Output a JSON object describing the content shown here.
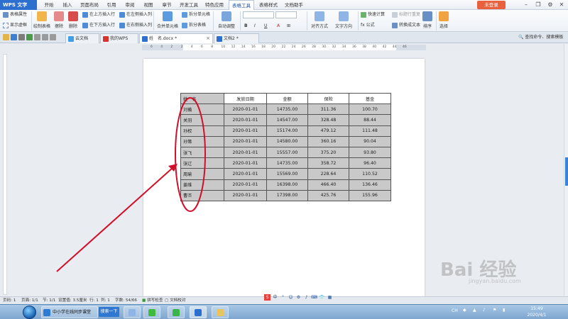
{
  "app": {
    "name": "WPS 文字",
    "login_label": "未登录"
  },
  "menu": {
    "items": [
      "开始",
      "插入",
      "页面布局",
      "引用",
      "审阅",
      "视图",
      "章节",
      "开发工具",
      "特色应用",
      "表格工具",
      "表格样式",
      "文档助手"
    ],
    "active": "表格工具"
  },
  "ribbon": {
    "table_props": "表格属性",
    "show_gridlines": "显示虚框",
    "draw_table": "绘制表格",
    "erase": "擦除",
    "delete": "删除",
    "insert_above": "在上方插入行",
    "insert_below": "在下方插入行",
    "insert_left": "在左侧插入列",
    "insert_right": "在右侧插入列",
    "merge_cells": "合并单元格",
    "split_cells": "拆分单元格",
    "split_table": "拆分表格",
    "autofit": "自动调整",
    "align": "对齐方式",
    "text_direction": "文字方向",
    "formula": "fx 公式",
    "quick_calc": "快速计算",
    "title_repeat": "标题行重复",
    "convert_text": "转换成文本",
    "sort": "排序",
    "select": "选择"
  },
  "tabs": {
    "cloud_doc": "云文档",
    "my_wps": "我的WPS",
    "doc_active": "姓　名.docx *",
    "doc2": "文档2 *",
    "find_cmd": "查找命令、搜索模板"
  },
  "ruler": {
    "ticks": [
      "6",
      "4",
      "2",
      "2",
      "4",
      "6",
      "8",
      "10",
      "12",
      "14",
      "16",
      "18",
      "20",
      "22",
      "24",
      "26",
      "28",
      "30",
      "32",
      "34",
      "36",
      "38",
      "40",
      "42",
      "44",
      "46"
    ]
  },
  "table": {
    "headers": [
      "姓　名",
      "发放日期",
      "金额",
      "保险",
      "基金"
    ],
    "rows": [
      [
        "刘備",
        "2020-01-01",
        "14735.00",
        "311.36",
        "100.70"
      ],
      [
        "关羽",
        "2020-01-01",
        "14547.00",
        "328.48",
        "88.44"
      ],
      [
        "孙权",
        "2020-01-01",
        "15174.00",
        "479.12",
        "111.48"
      ],
      [
        "孙策",
        "2020-01-01",
        "14580.00",
        "360.16",
        "90.04"
      ],
      [
        "张飞",
        "2020-01-01",
        "15557.00",
        "375.20",
        "93.80"
      ],
      [
        "张辽",
        "2020-01-01",
        "14735.00",
        "358.72",
        "96.40"
      ],
      [
        "周瑜",
        "2020-01-01",
        "15569.00",
        "228.64",
        "110.52"
      ],
      [
        "姜维",
        "2020-01-01",
        "16398.00",
        "466.40",
        "136.46"
      ],
      [
        "曹丕",
        "2020-01-01",
        "17398.00",
        "425.76",
        "155.96"
      ]
    ]
  },
  "status": {
    "page_num": "页码: 1",
    "page": "页面: 1/1",
    "section": "节: 1/1",
    "setting": "设置值: 3.5厘米",
    "row": "行: 1",
    "col": "列: 1",
    "words": "字数: 54/66",
    "spell": "拼写检查",
    "proofread": "文档校对"
  },
  "taskbar": {
    "browser_item": "中小学在线同步课堂",
    "search_btn": "搜索一下",
    "time": "15:49",
    "date": "2020/4/1",
    "ime_label": "CH"
  },
  "watermark": {
    "logo": "Bai 经验",
    "url": "jingyan.baidu.com"
  },
  "colors": {
    "accent": "#2c6fcf",
    "annotation": "#d0102a",
    "selection": "#c9c9c9"
  }
}
